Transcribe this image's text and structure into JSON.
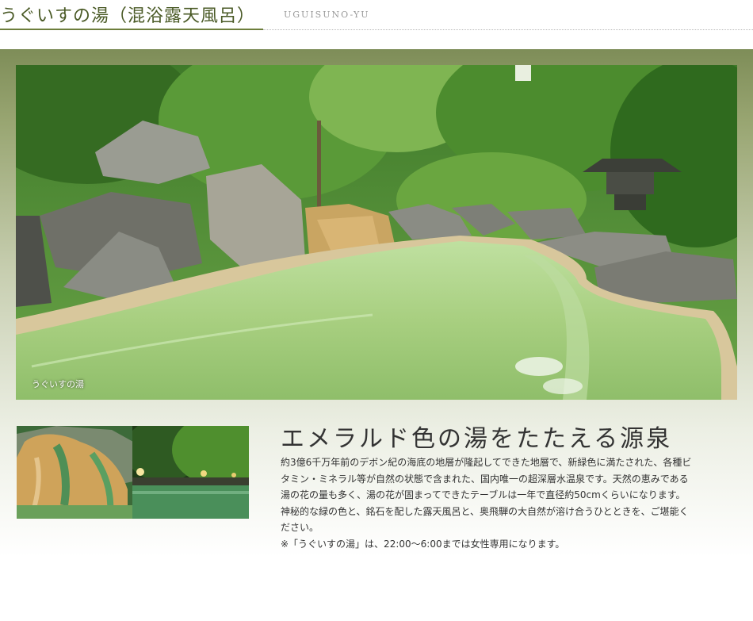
{
  "header": {
    "title": "うぐいすの湯（混浴露天風呂）",
    "subtitle": "UGUISUNO-YU"
  },
  "hero": {
    "caption": "うぐいすの湯"
  },
  "content": {
    "title": "エメラルド色の湯をたたえる源泉",
    "body": "約3億6千万年前のデボン紀の海底の地層が隆起してできた地層で、新緑色に満たされた、各種ビタミン・ミネラル等が自然の状態で含まれた、国内唯一の超深層水温泉です。天然の恵みである湯の花の量も多く、湯の花が固まってできたテーブルは一年で直径約50cmくらいになります。神秘的な緑の色と、銘石を配した露天風呂と、奥飛騨の大自然が溶け合うひとときを、ご堪能ください。",
    "note": "※「うぐいすの湯」は、22:00〜6:00までは女性専用になります。"
  },
  "colors": {
    "accent": "#6d7e3c",
    "band": "#7e8d58",
    "water": "#a9cf7a"
  }
}
